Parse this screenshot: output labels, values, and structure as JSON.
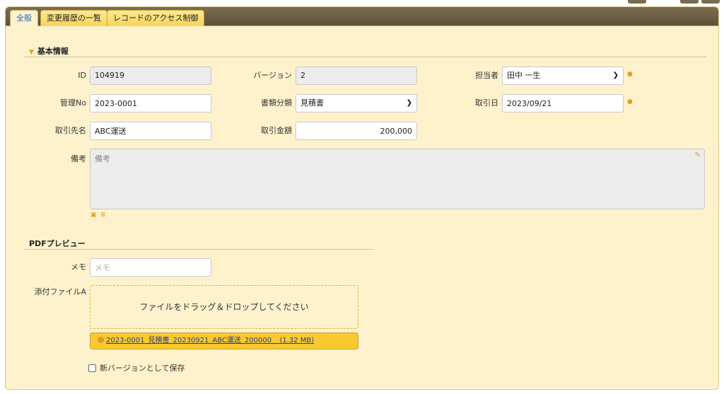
{
  "tabs": [
    {
      "label": "全般",
      "active": true
    },
    {
      "label": "変更履歴の一覧",
      "active": false
    },
    {
      "label": "レコードのアクセス制御",
      "active": false
    }
  ],
  "basic_section": {
    "title": "基本情報",
    "id_label": "ID",
    "id_value": "104919",
    "version_label": "バージョン",
    "version_value": "2",
    "owner_label": "担当者",
    "owner_value": "田中 一生",
    "mgmt_label": "管理No",
    "mgmt_value": "2023-0001",
    "doctype_label": "書類分類",
    "doctype_value": "見積書",
    "date_label": "取引日",
    "date_value": "2023/09/21",
    "partner_label": "取引先名",
    "partner_value": "ABC運送",
    "amount_label": "取引金額",
    "amount_value": "200,000",
    "note_label": "備考",
    "note_placeholder": "備考"
  },
  "pdf_section": {
    "title": "PDFプレビュー",
    "memo_label": "メモ",
    "memo_placeholder": "メモ",
    "attach_label": "添付ファイルA",
    "dropzone_text": "ファイルをドラッグ＆ドロップしてください",
    "file_name": "2023-0001_見積書_20230921_ABC運送_200000_",
    "file_size": "(1.32 MB)",
    "new_version_label": "新バージョンとして保存"
  },
  "colors": {
    "panel_bg": "#fdf2cc",
    "tab_active_text": "#2a66b5",
    "accent": "#e0a020",
    "file_bar": "#f9c930"
  },
  "icons": [
    "user-icon",
    "info-icon",
    "pencil-icon",
    "image-icon",
    "list-icon",
    "file-icon",
    "chevron-down-icon"
  ]
}
